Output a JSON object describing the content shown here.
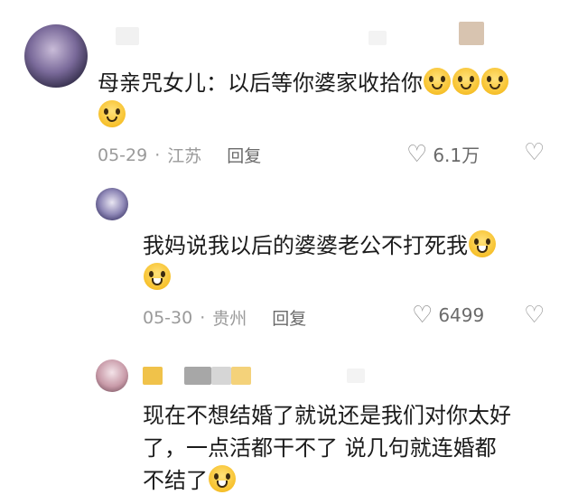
{
  "comments": [
    {
      "text": "母亲咒女儿：以后等你婆家收拾你",
      "date": "05-29",
      "location": "江苏",
      "reply_label": "回复",
      "likes": "6.1万",
      "emojis": [
        "smile-emoji",
        "smile-emoji",
        "smile-emoji",
        "smile-emoji"
      ]
    },
    {
      "text": "我妈说我以后的婆婆老公不打死我",
      "date": "05-30",
      "location": "贵州",
      "reply_label": "回复",
      "likes": "6499",
      "emojis": [
        "sweat-smile-emoji",
        "sweat-smile-emoji"
      ]
    },
    {
      "line1": "现在不想结婚了就说还是我们对你太好",
      "line2": "了，一点活都干不了 说几句就连婚都",
      "line3": "不结了",
      "emojis": [
        "sweat-smile-emoji"
      ]
    }
  ],
  "icons": {
    "like": "heart-icon",
    "dislike": "broken-heart-icon"
  },
  "colors": {
    "text": "#1b1b1b",
    "meta": "#9a9a9a"
  }
}
